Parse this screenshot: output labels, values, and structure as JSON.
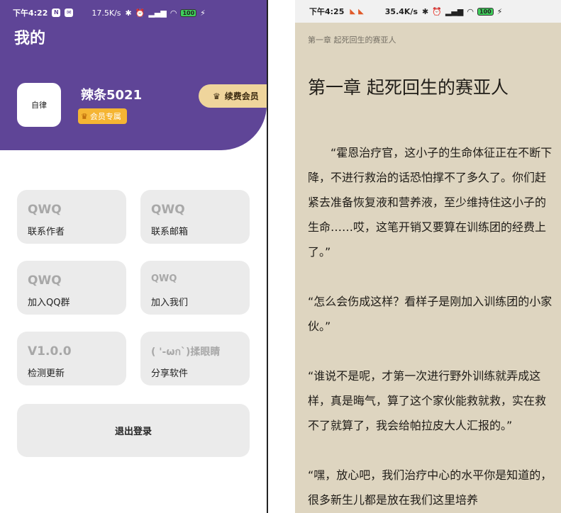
{
  "left": {
    "status": {
      "time": "下午4:22",
      "speed": "17.5K/s",
      "battery": "100"
    },
    "title": "我的",
    "profile": {
      "avatar_text": "自律",
      "username": "辣条5021",
      "vip_label": "会员专属",
      "renew_label": "续费会员"
    },
    "cards": [
      {
        "big": "QWQ",
        "label": "联系作者"
      },
      {
        "big": "QWQ",
        "label": "联系邮箱"
      },
      {
        "big": "QWQ",
        "label": "加入QQ群"
      },
      {
        "big": "QWQ",
        "label": "加入我们"
      },
      {
        "big": "V1.0.0",
        "label": "检测更新"
      },
      {
        "big": "( '-ωก`)揉眼睛",
        "label": "分享软件"
      }
    ],
    "logout_label": "退出登录"
  },
  "right": {
    "status": {
      "time": "下午4:25",
      "speed": "35.4K/s",
      "battery": "100"
    },
    "running_header": "第一章 起死回生的赛亚人",
    "chapter_title": "第一章 起死回生的赛亚人",
    "paragraphs": [
      "“霍恩治疗官，这小子的生命体征正在不断下降，不进行救治的话恐怕撑不了多久了。你们赶紧去准备恢复液和营养液，至少维持住这小子的生命……哎，这笔开销又要算在训练团的经费上了。”",
      "“怎么会伤成这样？看样子是刚加入训练团的小家伙。”",
      "“谁说不是呢，才第一次进行野外训练就弄成这样，真是晦气，算了这个家伙能救就救，实在救不了就算了，我会给帕拉皮大人汇报的。”",
      "“嘿，放心吧，我们治疗中心的水平你是知道的，很多新生儿都是放在我们这里培养"
    ]
  }
}
